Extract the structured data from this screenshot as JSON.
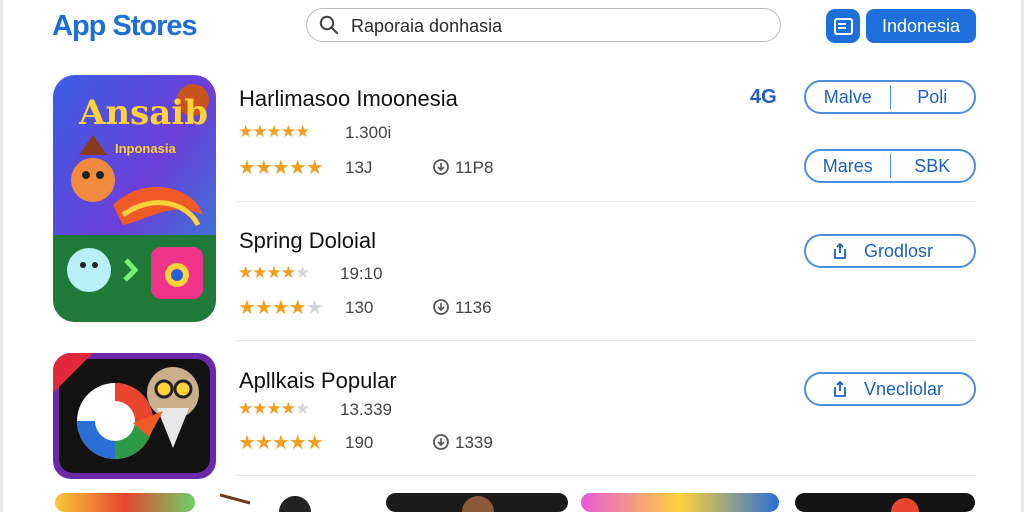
{
  "header": {
    "logo": "App Stores",
    "search_value": "Raporaia donhasia",
    "region_button": "Indonesia"
  },
  "featured_icon": {
    "title_text": "Ansaib",
    "subtitle_text": "Inponasia"
  },
  "rows": [
    {
      "title": "Harlimasoo Imoonesia",
      "lines": [
        {
          "stars": "★★★★★",
          "dim": "",
          "count": "1.300i"
        },
        {
          "stars": "★★★★★",
          "dim": "",
          "count": "13J",
          "size": "11P8"
        }
      ],
      "badge": "4G",
      "buttons": [
        {
          "left": "Malve",
          "right": "Poli"
        },
        {
          "left": "Mares",
          "right": "SBK"
        }
      ]
    },
    {
      "title": "Spring Doloial",
      "lines": [
        {
          "stars": "★★★★",
          "dim": "★",
          "count": "19:10"
        },
        {
          "stars": "★★★★",
          "dim": "★",
          "count": "130",
          "size": "1136"
        }
      ],
      "button": "Grodlosr"
    },
    {
      "title": "Apllkais Popular",
      "lines": [
        {
          "stars": "★★★★",
          "dim": "★",
          "count": "13.339"
        },
        {
          "stars": "★★★★★",
          "dim": "",
          "count": "190",
          "size": "1339"
        }
      ],
      "button": "Vnecliolar"
    }
  ],
  "colors": {
    "accent": "#1d6fdc",
    "star": "#f0a020",
    "pill_border": "#4a8fe0"
  }
}
